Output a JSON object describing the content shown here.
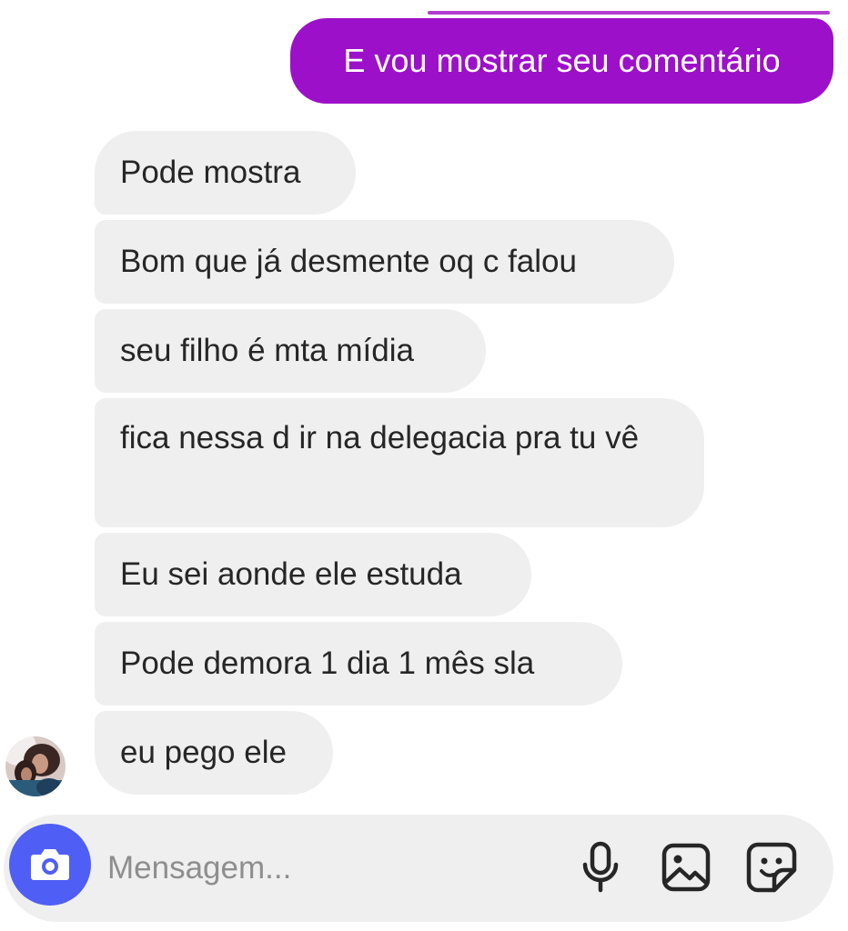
{
  "thread": {
    "sent_message": "E vou mostrar seu comentário",
    "received_messages": [
      "Pode mostra",
      "Bom que já desmente oq c falou",
      "seu filho é mta mídia",
      "fica nessa d ir na delegacia pra tu vê",
      "Eu sei aonde ele estuda",
      "Pode demora 1 dia 1 mês sla",
      "eu pego ele"
    ]
  },
  "composer": {
    "placeholder": "Mensagem...",
    "icons": [
      "camera-icon",
      "microphone-icon",
      "gallery-icon",
      "sticker-icon"
    ]
  },
  "colors": {
    "sent_bubble": "#9d10c9",
    "received_bubble": "#efefef",
    "camera_button": "#4f5ef4",
    "text_dark": "#262626",
    "placeholder": "#8e8e8e"
  }
}
